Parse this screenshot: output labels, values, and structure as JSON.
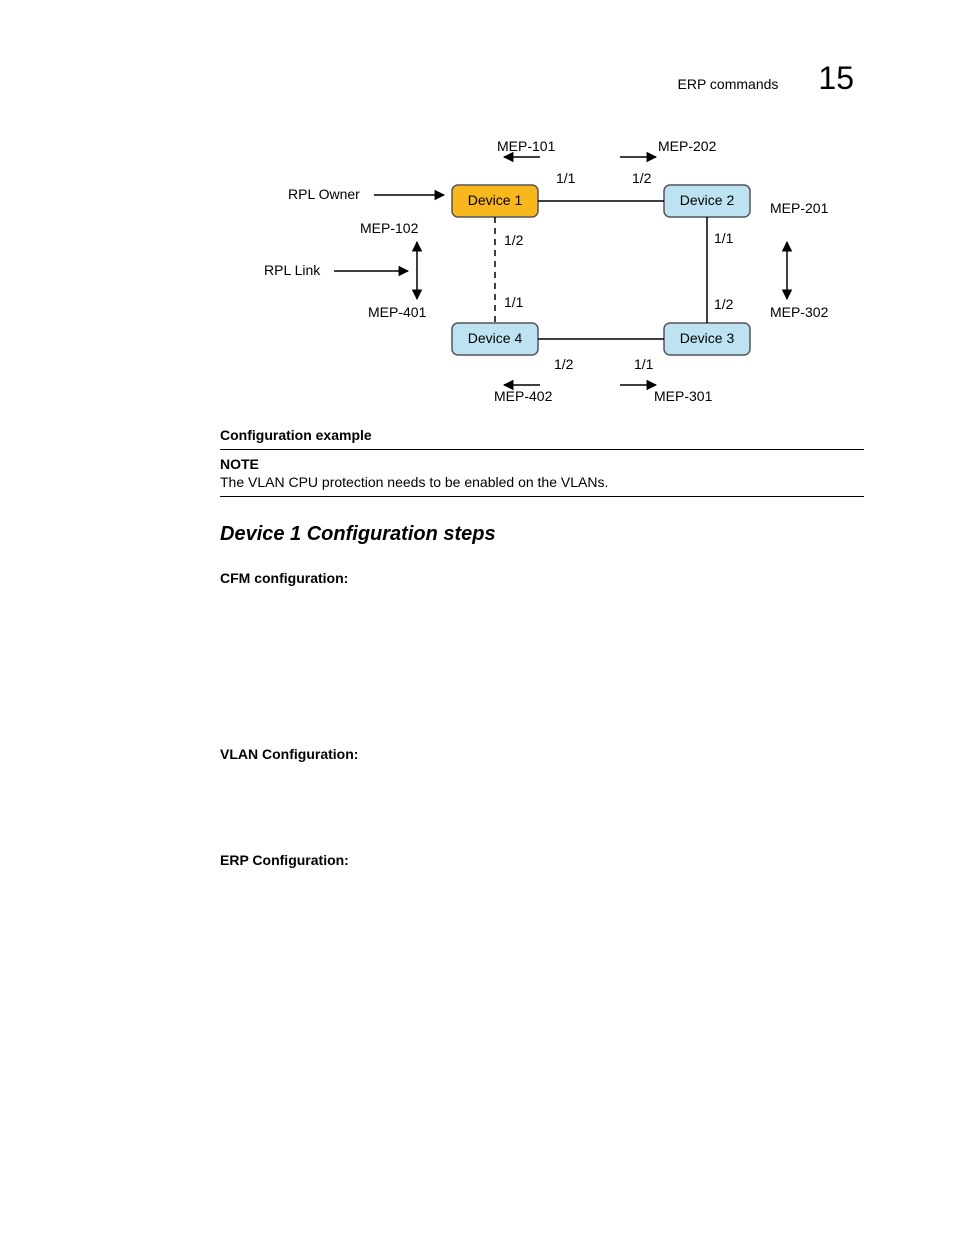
{
  "header": {
    "label": "ERP commands",
    "num": "15"
  },
  "diagram": {
    "devices": {
      "d1": "Device 1",
      "d2": "Device 2",
      "d3": "Device 3",
      "d4": "Device 4"
    },
    "meps": {
      "top_left": "MEP-101",
      "top_right": "MEP-202",
      "left_upper": "MEP-102",
      "left_lower": "MEP-401",
      "right_upper": "MEP-201",
      "right_lower": "MEP-302",
      "bottom_left": "MEP-402",
      "bottom_right": "MEP-301"
    },
    "ports": {
      "d1_right": "1/1",
      "d2_left": "1/2",
      "d1_bottom": "1/2",
      "d4_top": "1/1",
      "d2_bottom": "1/1",
      "d3_top": "1/2",
      "d4_right": "1/2",
      "d3_left": "1/1"
    },
    "labels": {
      "rpl_owner": "RPL Owner",
      "rpl_link": "RPL Link"
    }
  },
  "caption": "Configuration example",
  "note": {
    "label": "NOTE",
    "text": "The VLAN CPU protection needs to be enabled on the VLANs."
  },
  "section_title": "Device 1 Configuration steps",
  "subheads": {
    "cfm": "CFM configuration:",
    "vlan": "VLAN Configuration:",
    "erp": "ERP Configuration:"
  }
}
